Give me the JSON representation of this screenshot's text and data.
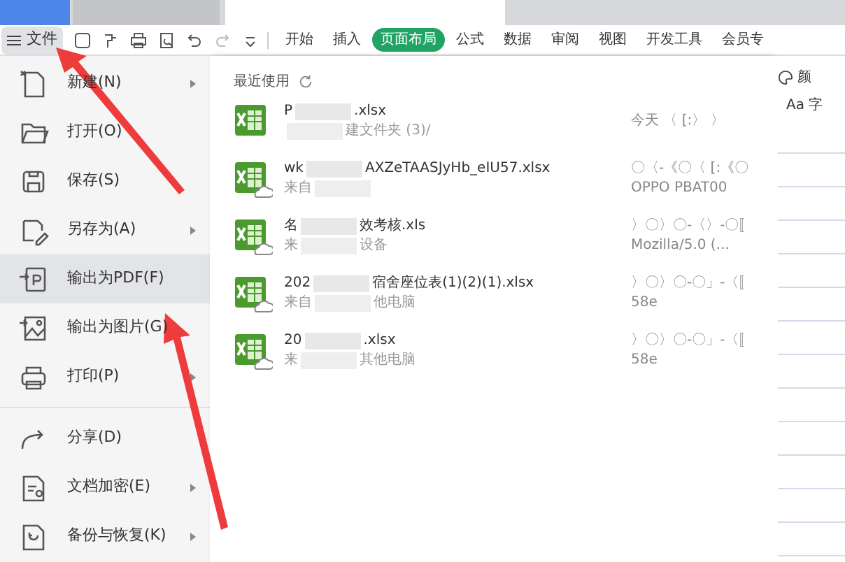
{
  "toolbar": {
    "file_menu": "文件",
    "tabs": [
      {
        "label": "开始",
        "selected": false
      },
      {
        "label": "插入",
        "selected": false
      },
      {
        "label": "页面布局",
        "selected": true
      },
      {
        "label": "公式",
        "selected": false
      },
      {
        "label": "数据",
        "selected": false
      },
      {
        "label": "审阅",
        "selected": false
      },
      {
        "label": "视图",
        "selected": false
      },
      {
        "label": "开发工具",
        "selected": false
      },
      {
        "label": "会员专",
        "selected": false
      }
    ]
  },
  "menu": [
    {
      "label": "新建(N)",
      "submenu": true,
      "selected": false
    },
    {
      "label": "打开(O)",
      "submenu": false,
      "selected": false
    },
    {
      "label": "保存(S)",
      "submenu": false,
      "selected": false
    },
    {
      "label": "另存为(A)",
      "submenu": true,
      "selected": false
    },
    {
      "label": "输出为PDF(F)",
      "submenu": false,
      "selected": true
    },
    {
      "label": "输出为图片(G)",
      "submenu": false,
      "selected": false
    },
    {
      "label": "打印(P)",
      "submenu": true,
      "selected": false
    },
    {
      "label": "分享(D)",
      "submenu": false,
      "selected": false
    },
    {
      "label": "文档加密(E)",
      "submenu": true,
      "selected": false
    },
    {
      "label": "备份与恢复(K)",
      "submenu": true,
      "selected": false
    }
  ],
  "recent": {
    "title": "最近使用",
    "files": [
      {
        "name_start": "P",
        "name_end": ".xlsx",
        "path_end": "建文件夹 (3)/",
        "time": "今天 〈 [:〉 〉",
        "cloud": false
      },
      {
        "name_start": "wk",
        "name_end": "AXZeTAASJyHb_eIU57.xlsx",
        "path_start": "来自",
        "time": "〇〈-《〇〈 [:《〇",
        "device": "OPPO PBAT00",
        "cloud": true
      },
      {
        "name_start": "名",
        "name_end": "效考核.xls",
        "path_start": "来",
        "path_end": "设备",
        "time": "〉〇〉〇-〈〉-〇〚",
        "device": "Mozilla/5.0 (...",
        "cloud": true
      },
      {
        "name_start": "202",
        "name_end": "宿舍座位表(1)(2)(1).xlsx",
        "path_start": "来自",
        "path_end": "他电脑",
        "time": "〉〇〉〇-〇」-〈〚",
        "device": "58e",
        "cloud": true
      },
      {
        "name_start": "20",
        "name_end": ".xlsx",
        "path_start": "来",
        "path_end": "其他电脑",
        "time": "〉〇〉〇-〇」-〈〚",
        "device": "58e",
        "cloud": true
      }
    ]
  },
  "side": {
    "color_label": "颜",
    "font_label": "Aa 字"
  }
}
